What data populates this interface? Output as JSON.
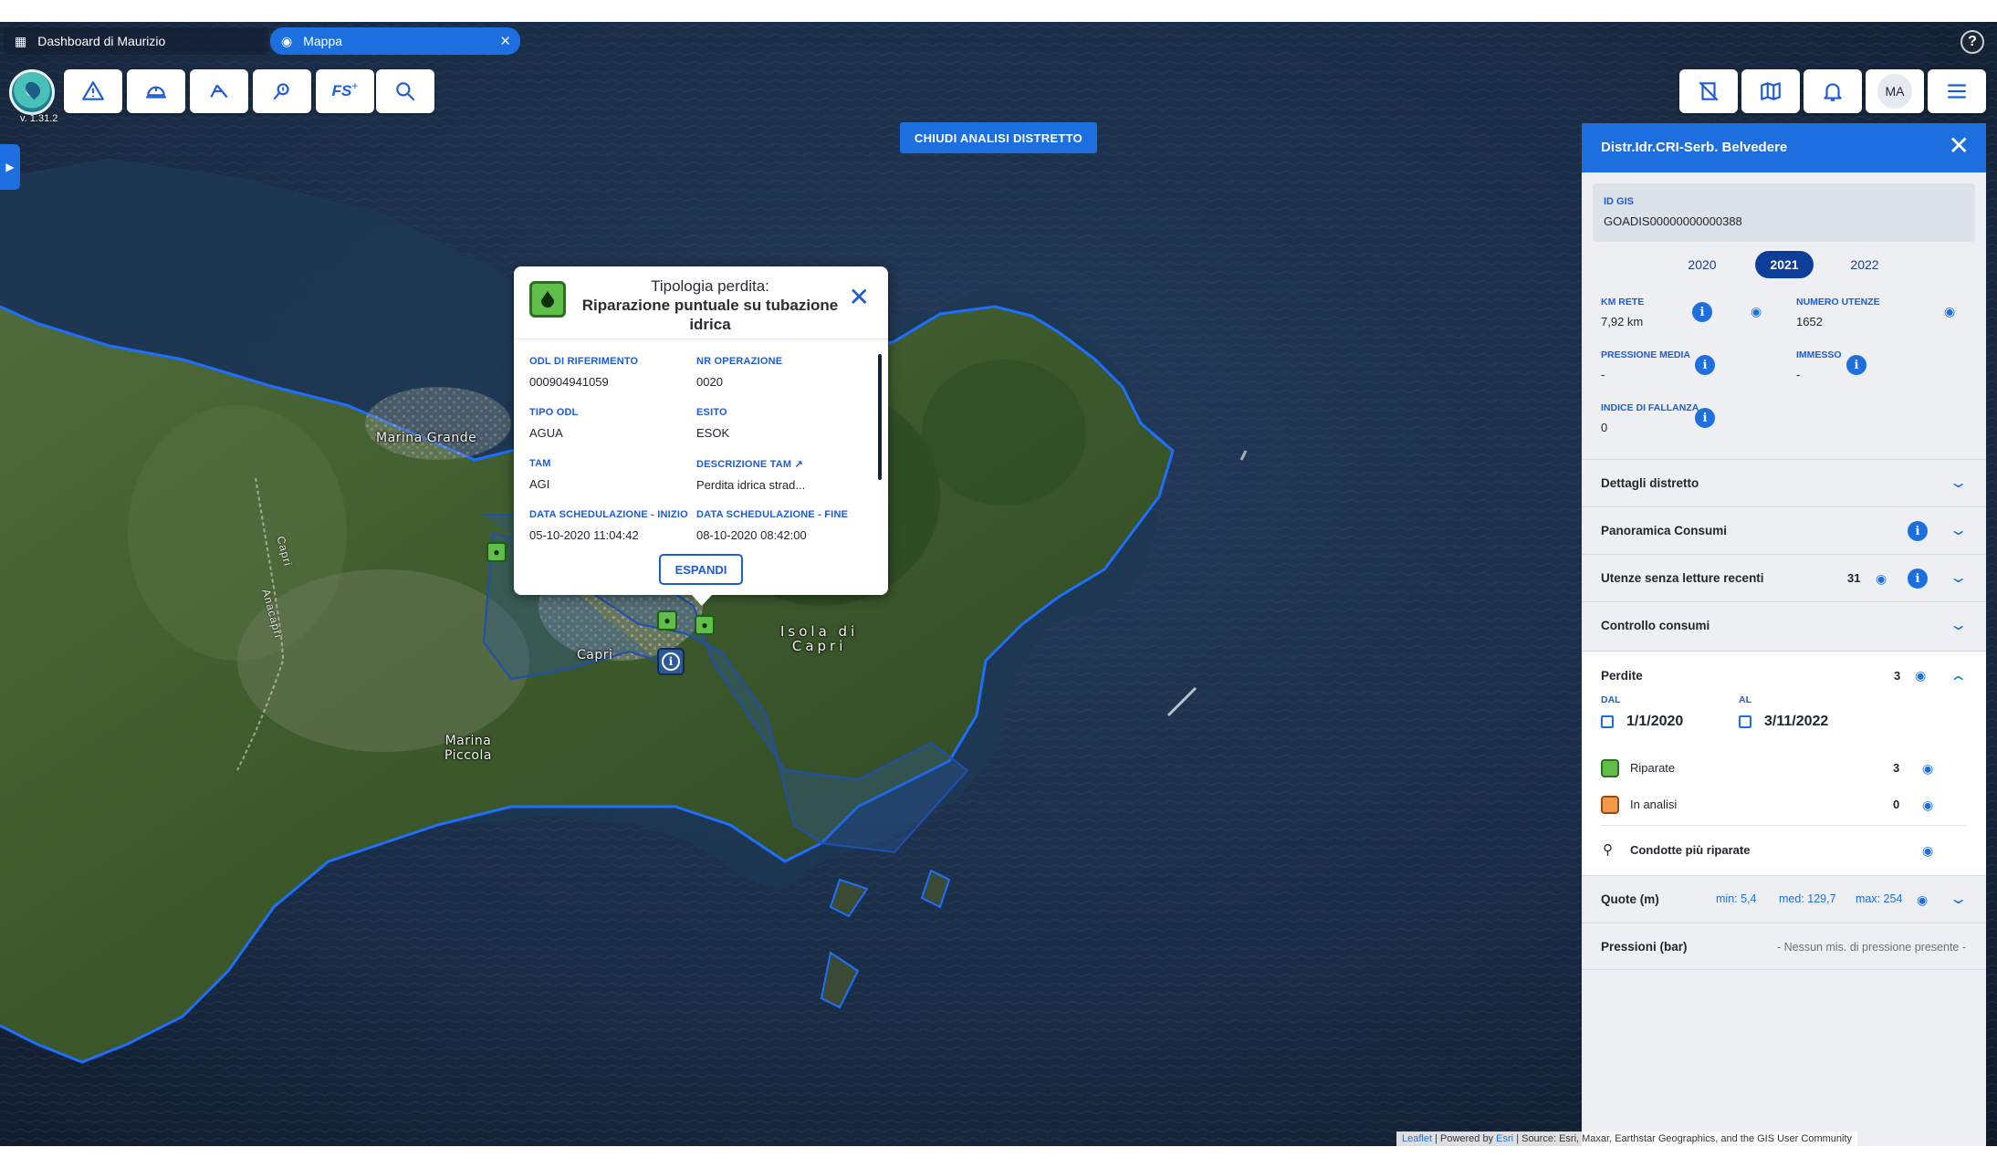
{
  "tabs": {
    "dashboard": "Dashboard di Maurizio",
    "map": "Mappa"
  },
  "app": {
    "version": "v. 1.31.2"
  },
  "toolbar": {
    "fs_label": "FS",
    "close_analysis": "CHIUDI ANALISI DISTRETTO",
    "avatar": "MA"
  },
  "map": {
    "labels": {
      "marina_grande": "Marina Grande",
      "capri": "Capri",
      "isola": "Isola di\nCapri",
      "marina_piccola": "Marina\nPiccola",
      "road_capri": "Capri",
      "road_anacapri": "Anacapri"
    }
  },
  "popup": {
    "title_line1": "Tipologia perdita:",
    "title_line2": "Riparazione puntuale su tubazione idrica",
    "fields": {
      "odl_label": "ODL DI RIFERIMENTO",
      "odl_value": "000904941059",
      "nr_op_label": "NR OPERAZIONE",
      "nr_op_value": "0020",
      "tipo_label": "TIPO ODL",
      "tipo_value": "AGUA",
      "esito_label": "ESITO",
      "esito_value": "ESOK",
      "tam_label": "TAM",
      "tam_value": "AGI",
      "desc_tam_label": "DESCRIZIONE TAM",
      "desc_tam_value": "Perdita idrica strad...",
      "inizio_label": "DATA SCHEDULAZIONE - INIZIO",
      "inizio_value": "05-10-2020 11:04:42",
      "fine_label": "DATA SCHEDULAZIONE - FINE",
      "fine_value": "08-10-2020 08:42:00"
    },
    "expand": "ESPANDI"
  },
  "panel": {
    "title": "Distr.Idr.CRI-Serb. Belvedere",
    "gis_label": "ID GIS",
    "gis_value": "GOADIS00000000000388",
    "years": [
      "2020",
      "2021",
      "2022"
    ],
    "active_year": "2021",
    "stats": {
      "km_label": "KM RETE",
      "km_value": "7,92 km",
      "utenze_label": "NUMERO UTENZE",
      "utenze_value": "1652",
      "pressione_label": "PRESSIONE MEDIA",
      "pressione_value": "-",
      "immesso_label": "IMMESSO",
      "immesso_value": "-",
      "fallanza_label": "INDICE DI FALLANZA",
      "fallanza_value": "0"
    },
    "sections": {
      "dettagli": "Dettagli distretto",
      "panoramica": "Panoramica Consumi",
      "utenze_senza": "Utenze senza letture recenti",
      "utenze_senza_count": "31",
      "controllo": "Controllo consumi"
    },
    "perdite": {
      "title": "Perdite",
      "count": "3",
      "dal_label": "DAL",
      "dal_value": "1/1/2020",
      "al_label": "AL",
      "al_value": "3/11/2022",
      "riparate_label": "Riparate",
      "riparate_count": "3",
      "analisi_label": "In analisi",
      "analisi_count": "0",
      "condotte": "Condotte più riparate"
    },
    "quote": {
      "title": "Quote (m)",
      "min": "min: 5,4",
      "med": "med: 129,7",
      "max": "max: 254"
    },
    "pressioni": {
      "title": "Pressioni (bar)",
      "msg": "- Nessun mis. di pressione presente -"
    }
  },
  "attribution": {
    "leaflet": "Leaflet",
    "powered": "| Powered by",
    "esri": "Esri",
    "source": "| Source: Esri, Maxar, Earthstar Geographics, and the GIS User Community"
  },
  "colors": {
    "accent": "#1d6fe0",
    "dark_accent": "#0d3f9a",
    "leak_repaired": "#5fbf4a",
    "leak_analysis": "#f09a4a",
    "district_outline": "#1f6fff"
  }
}
